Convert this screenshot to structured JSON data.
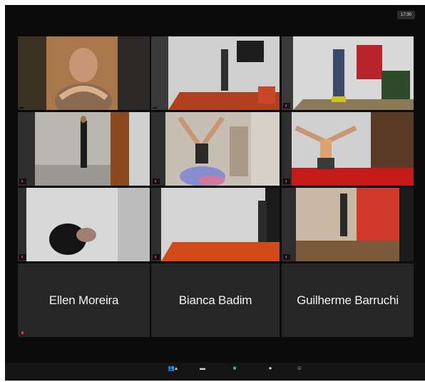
{
  "clock": "17:30",
  "participants": [
    {
      "name": "",
      "active": true
    },
    {
      "name": ""
    },
    {
      "name": ""
    },
    {
      "name": ""
    },
    {
      "name": ""
    },
    {
      "name": ""
    },
    {
      "name": ""
    },
    {
      "name": ""
    },
    {
      "name": ""
    }
  ],
  "name_only_tiles": [
    {
      "name": "Ellen Moreira"
    },
    {
      "name": "Bianca Badim"
    },
    {
      "name": "Guilherme Barruchi"
    }
  ],
  "toolbar": {
    "items": [
      {
        "label": ""
      },
      {
        "label": ""
      },
      {
        "label": ""
      },
      {
        "label": ""
      },
      {
        "label": ""
      }
    ]
  },
  "colors": {
    "active_speaker_border": "#b6d64c",
    "share_screen_green": "#35c24e",
    "muted_red": "#e04040"
  }
}
